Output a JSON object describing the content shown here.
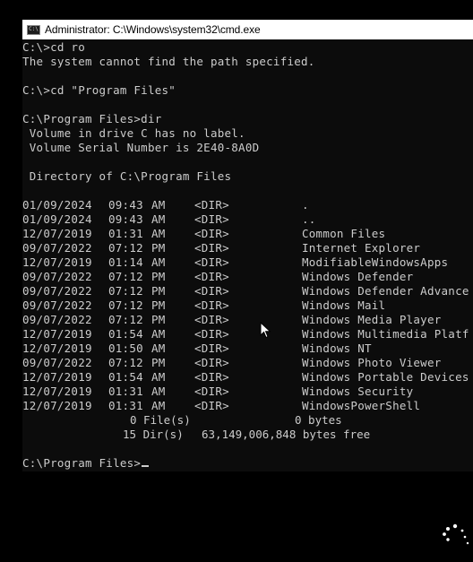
{
  "window": {
    "title": "Administrator: C:\\Windows\\system32\\cmd.exe",
    "icon_label": "C:\\"
  },
  "console": {
    "lines": [
      "C:\\>cd ro",
      "The system cannot find the path specified.",
      "",
      "C:\\>cd \"Program Files\"",
      "",
      "C:\\Program Files>dir",
      " Volume in drive C has no label.",
      " Volume Serial Number is 2E40-8A0D",
      "",
      " Directory of C:\\Program Files",
      ""
    ],
    "entries": [
      {
        "date": "01/09/2024",
        "time": "09:43",
        "ampm": "AM",
        "type": "<DIR>",
        "name": "."
      },
      {
        "date": "01/09/2024",
        "time": "09:43",
        "ampm": "AM",
        "type": "<DIR>",
        "name": ".."
      },
      {
        "date": "12/07/2019",
        "time": "01:31",
        "ampm": "AM",
        "type": "<DIR>",
        "name": "Common Files"
      },
      {
        "date": "09/07/2022",
        "time": "07:12",
        "ampm": "PM",
        "type": "<DIR>",
        "name": "Internet Explorer"
      },
      {
        "date": "12/07/2019",
        "time": "01:14",
        "ampm": "AM",
        "type": "<DIR>",
        "name": "ModifiableWindowsApps"
      },
      {
        "date": "09/07/2022",
        "time": "07:12",
        "ampm": "PM",
        "type": "<DIR>",
        "name": "Windows Defender"
      },
      {
        "date": "09/07/2022",
        "time": "07:12",
        "ampm": "PM",
        "type": "<DIR>",
        "name": "Windows Defender Advance"
      },
      {
        "date": "09/07/2022",
        "time": "07:12",
        "ampm": "PM",
        "type": "<DIR>",
        "name": "Windows Mail"
      },
      {
        "date": "09/07/2022",
        "time": "07:12",
        "ampm": "PM",
        "type": "<DIR>",
        "name": "Windows Media Player"
      },
      {
        "date": "12/07/2019",
        "time": "01:54",
        "ampm": "AM",
        "type": "<DIR>",
        "name": "Windows Multimedia Platf"
      },
      {
        "date": "12/07/2019",
        "time": "01:50",
        "ampm": "AM",
        "type": "<DIR>",
        "name": "Windows NT"
      },
      {
        "date": "09/07/2022",
        "time": "07:12",
        "ampm": "PM",
        "type": "<DIR>",
        "name": "Windows Photo Viewer"
      },
      {
        "date": "12/07/2019",
        "time": "01:54",
        "ampm": "AM",
        "type": "<DIR>",
        "name": "Windows Portable Devices"
      },
      {
        "date": "12/07/2019",
        "time": "01:31",
        "ampm": "AM",
        "type": "<DIR>",
        "name": "Windows Security"
      },
      {
        "date": "12/07/2019",
        "time": "01:31",
        "ampm": "AM",
        "type": "<DIR>",
        "name": "WindowsPowerShell"
      }
    ],
    "summary": {
      "files_count": "0 File(s)",
      "files_bytes": "0 bytes",
      "dirs_count": "15 Dir(s)",
      "dirs_free": "63,149,006,848 bytes free"
    },
    "prompt": "C:\\Program Files>"
  },
  "icons": {
    "mouse_pointer": "arrow-cursor-icon",
    "loading": "loading-spinner-icon"
  },
  "colors": {
    "console_bg": "#0c0c0c",
    "console_text": "#cccccc",
    "titlebar_bg": "#ffffff"
  }
}
